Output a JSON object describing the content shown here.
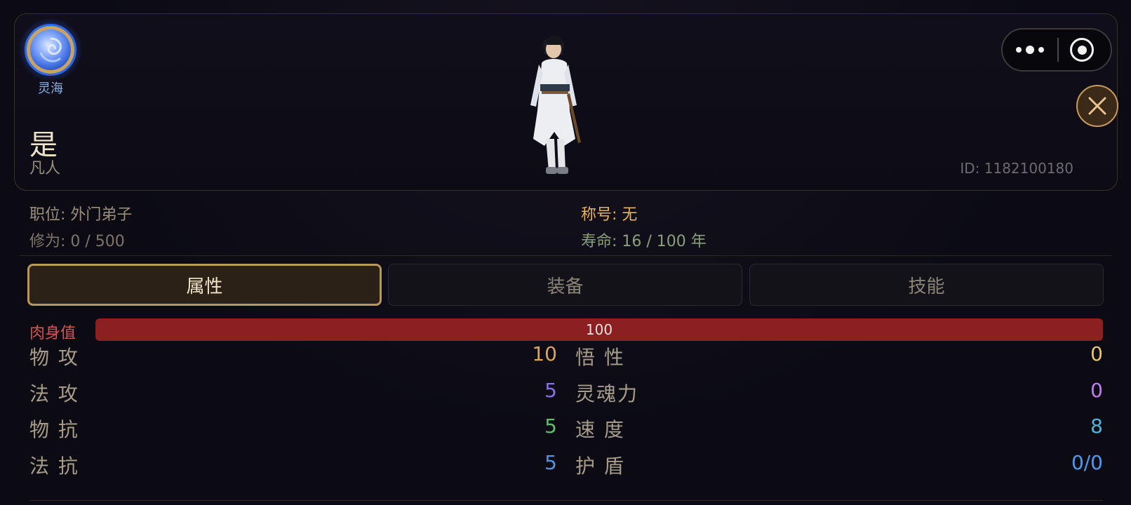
{
  "header": {
    "realm_badge": {
      "label": "灵海",
      "icon": "spirit-sea-orb-icon"
    },
    "character": {
      "name": "是",
      "rank": "凡人",
      "id_text": "ID: 1182100180"
    },
    "menu_capsule": {
      "more_icon": "more-dots-icon",
      "target_icon": "target-icon"
    },
    "close_icon": "close-icon"
  },
  "info": {
    "position": "职位: 外门弟子",
    "title": "称号: 无",
    "cultivation": "修为: 0 / 500",
    "lifespan": "寿命: 16 / 100 年"
  },
  "tabs": [
    {
      "label": "属性",
      "active": true
    },
    {
      "label": "装备",
      "active": false
    },
    {
      "label": "技能",
      "active": false
    }
  ],
  "hp": {
    "label": "肉身值",
    "value": "100",
    "fill_fraction": 1.0,
    "color": "#8b1f22"
  },
  "stats_left": [
    {
      "name": "物 攻",
      "value": "10",
      "color": "#d9a55b"
    },
    {
      "name": "法 攻",
      "value": "5",
      "color": "#8b6df0"
    },
    {
      "name": "物 抗",
      "value": "5",
      "color": "#5cbf6a"
    },
    {
      "name": "法 抗",
      "value": "5",
      "color": "#5a8fe0"
    }
  ],
  "stats_right": [
    {
      "name": "悟 性",
      "value": "0",
      "color": "#e6c56b"
    },
    {
      "name": "灵魂力",
      "value": "0",
      "color": "#c07cf0"
    },
    {
      "name": "速 度",
      "value": "8",
      "color": "#4ab6df"
    },
    {
      "name": "护 盾",
      "value": "0/0",
      "color": "#4a9af0"
    }
  ],
  "colors": {
    "accent_gold": "#b8975b",
    "info_label": "#9a8e7c",
    "title_gold": "#e8b35a",
    "lifespan_green": "#88a07a"
  }
}
